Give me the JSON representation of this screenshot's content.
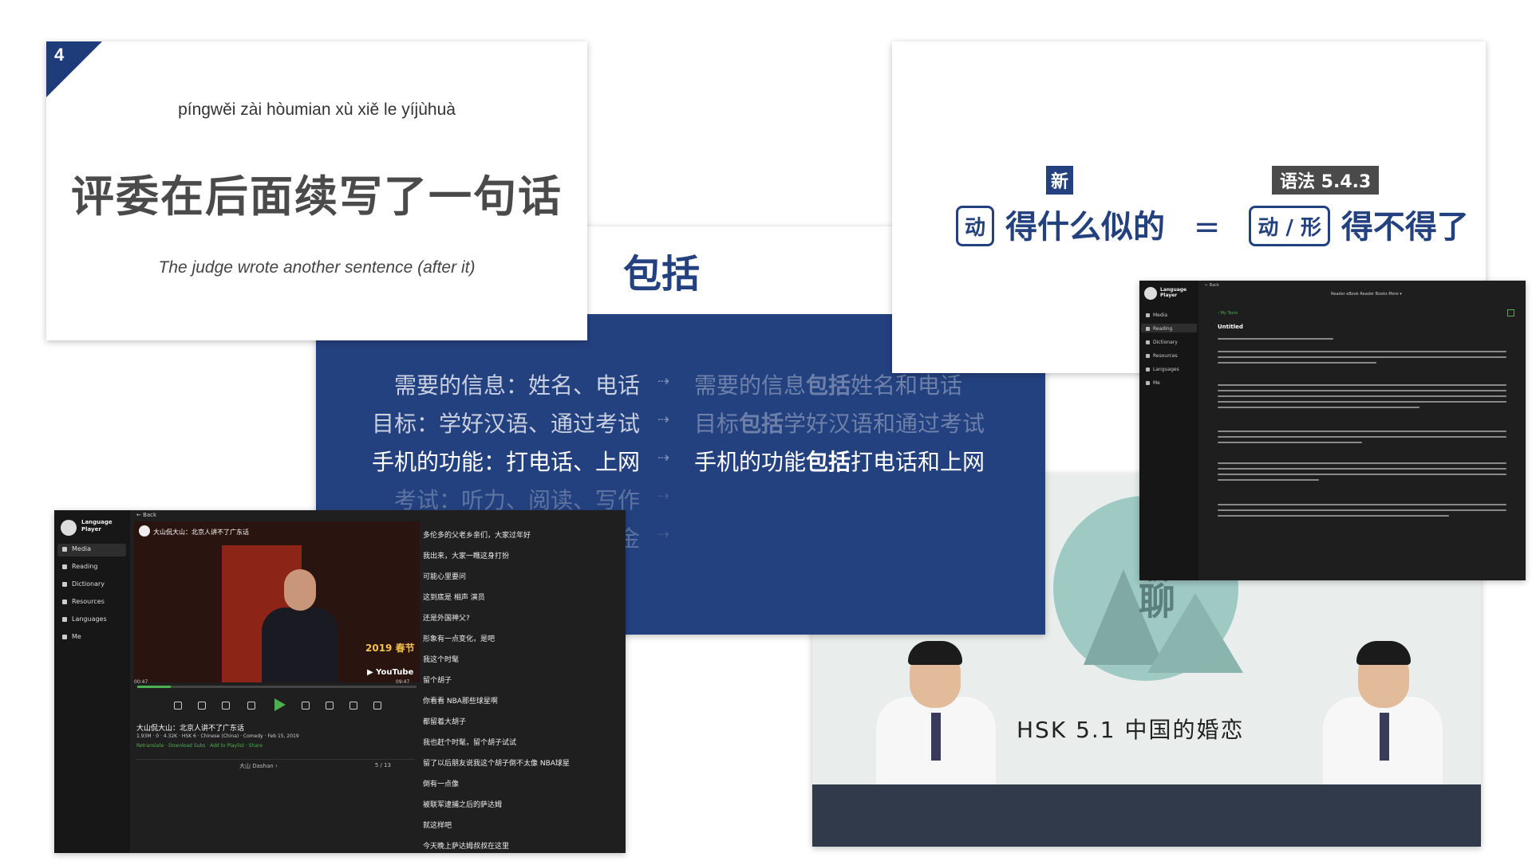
{
  "flashcard": {
    "number": "4",
    "pinyin": "píngwěi zài hòumian xù xiě le yíjùhuà",
    "hanzi": "评委在后面续写了一句话",
    "english": "The judge wrote another sentence (after it)"
  },
  "grammar_card": {
    "title": "包括",
    "rows": [
      {
        "left": "需要的信息：姓名、电话",
        "arrow": "⇢",
        "right_pre": "需要的信息",
        "right_bold": "包括",
        "right_post": "姓名和电话",
        "dim": true
      },
      {
        "left": "目标：学好汉语、通过考试",
        "arrow": "⇢",
        "right_pre": "目标",
        "right_bold": "包括",
        "right_post": "学好汉语和通过考试",
        "dim": true
      },
      {
        "left": "手机的功能：打电话、上网",
        "arrow": "⇢",
        "right_pre": "手机的功能",
        "right_bold": "包括",
        "right_post": "打电话和上网",
        "dim": false
      },
      {
        "left": "考试：听力、阅读、写作",
        "arrow": "⇢",
        "right_pre": "",
        "right_bold": "",
        "right_post": "",
        "dim": true
      },
      {
        "left": "金",
        "arrow": "⇢",
        "right_pre": "",
        "right_bold": "",
        "right_post": "",
        "dim": true
      }
    ]
  },
  "formula_card": {
    "badge_new": "新",
    "badge_grammar": "语法 5.4.3",
    "left_box": "动",
    "left_text": "得什么似的",
    "equals": "=",
    "right_box": "动 / 形",
    "right_text": "得不得了"
  },
  "video_card": {
    "circle_chars": "聊聊",
    "title": "HSK 5.1  中国的婚恋"
  },
  "reader_app": {
    "brand_line1": "Language",
    "brand_line2": "Player",
    "back": "← Back",
    "nav": [
      "Media",
      "Reading",
      "Dictionary",
      "Resources",
      "Languages",
      "Me"
    ],
    "top_nav": "Reader   eBook Reader   Books   More ▾",
    "my_texts": "‹ My Texts",
    "doc_title": "Untitled"
  },
  "player_app": {
    "brand_line1": "Language",
    "brand_line2": "Player",
    "back": "← Back",
    "nav": [
      "Media",
      "Reading",
      "Dictionary",
      "Resources",
      "Languages",
      "Me"
    ],
    "video_title": "大山侃大山：北京人讲不了广东话",
    "sign_text": "2019 春节",
    "youtube": "▶ YouTube",
    "time_current": "00:47",
    "time_total": "09:47",
    "title": "大山侃大山：北京人讲不了广东话",
    "meta": "1.93M · 0 · 4.32K · HSK 6 · Chinese (China) · Comedy · Feb 15, 2019",
    "meta2": "Retranslate · Download Subs · Add to Playlist · Share",
    "footer_title": "大山 Dashan ›",
    "footer_count": "5 / 13",
    "subtitles": [
      "多伦多的父老乡亲们，大家过年好",
      "我出来，大家一瞧这身打扮",
      "可能心里要问",
      "这到底是 相声 演员",
      "还是外国神父?",
      "形象有一点变化，是吧",
      "我这个时髦",
      "留个胡子",
      "你看看 NBA那些球星啊",
      "都留着大胡子",
      "我也赶个时髦，留个胡子试试",
      "留了以后朋友说我这个胡子倒不太像 NBA球星",
      "倒有一点像",
      "被联军逮捕之后的萨达姆",
      "就这样吧",
      "今天晚上萨达姆叔叔在这里"
    ]
  }
}
